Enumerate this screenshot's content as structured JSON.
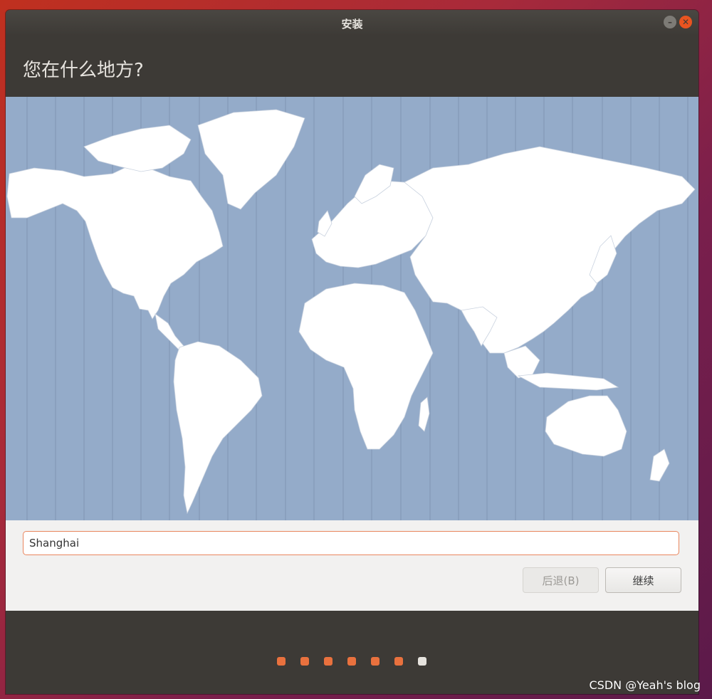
{
  "window": {
    "title": "安装",
    "minimize_glyph": "–",
    "close_glyph": "✕"
  },
  "page": {
    "heading": "您在什么地方?"
  },
  "location": {
    "value": "Shanghai"
  },
  "buttons": {
    "back_label": "后退(B)",
    "continue_label": "继续"
  },
  "progress": {
    "total_steps": 7,
    "current_step": 7
  },
  "watermark": "CSDN @Yeah's blog",
  "colors": {
    "accent": "#e95420",
    "ocean": "#94abc9",
    "land": "#ffffff",
    "window_bg": "#3d3a36"
  },
  "icons": [
    "minimize-icon",
    "close-icon",
    "world-map"
  ]
}
